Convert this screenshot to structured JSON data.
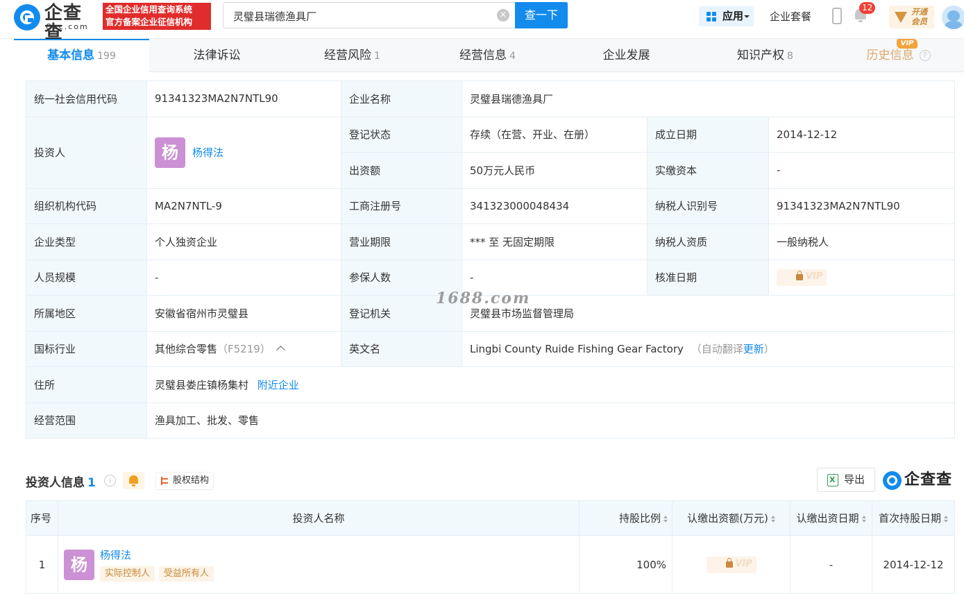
{
  "header": {
    "logo_cn": "企查查",
    "logo_en": "Qcc.com",
    "slogan_line1": "全国企业信用查询系统",
    "slogan_line2": "官方备案企业征信机构",
    "search_value": "灵璧县瑞德渔具厂",
    "search_button": "查一下",
    "app_label": "应用",
    "package_label": "企业套餐",
    "notification_count": "12",
    "vip_open_label": "开通会员",
    "accent_color": "#128bed"
  },
  "tabs": [
    {
      "label": "基本信息",
      "count": "199"
    },
    {
      "label": "法律诉讼",
      "count": ""
    },
    {
      "label": "经营风险",
      "count": "1"
    },
    {
      "label": "经营信息",
      "count": "4"
    },
    {
      "label": "企业发展",
      "count": ""
    },
    {
      "label": "知识产权",
      "count": "8"
    },
    {
      "label": "历史信息",
      "count": ""
    }
  ],
  "vip_tag": "VIP",
  "basic_info": {
    "credit_code_label": "统一社会信用代码",
    "credit_code": "91341323MA2N7NTL90",
    "company_name_label": "企业名称",
    "company_name": "灵璧县瑞德渔具厂",
    "investor_label": "投资人",
    "investor_avatar": "杨",
    "investor_name": "杨得法",
    "reg_status_label": "登记状态",
    "reg_status": "存续（在营、开业、在册）",
    "founded_label": "成立日期",
    "founded": "2014-12-12",
    "capital_label": "出资额",
    "capital": "50万元人民币",
    "paid_capital_label": "实缴资本",
    "paid_capital": "-",
    "org_code_label": "组织机构代码",
    "org_code": "MA2N7NTL-9",
    "biz_reg_no_label": "工商注册号",
    "biz_reg_no": "341323000048434",
    "taxpayer_id_label": "纳税人识别号",
    "taxpayer_id": "91341323MA2N7NTL90",
    "company_type_label": "企业类型",
    "company_type": "个人独资企业",
    "biz_term_label": "营业期限",
    "biz_term": "*** 至 无固定期限",
    "taxpayer_qual_label": "纳税人资质",
    "taxpayer_qual": "一般纳税人",
    "staff_size_label": "人员规模",
    "staff_size": "-",
    "insured_label": "参保人数",
    "insured": "-",
    "approval_date_label": "核准日期",
    "region_label": "所属地区",
    "region": "安徽省宿州市灵璧县",
    "reg_authority_label": "登记机关",
    "reg_authority": "灵璧县市场监督管理局",
    "industry_label": "国标行业",
    "industry": "其他综合零售",
    "industry_code": "（F5219）",
    "english_name_label": "英文名",
    "english_name": "Lingbi County Ruide Fishing Gear Factory",
    "auto_translate_prefix": "（自动翻译",
    "auto_translate_link": "更新",
    "auto_translate_suffix": "）",
    "address_label": "住所",
    "address": "灵璧县娄庄镇杨集村",
    "nearby_link": "附近企业",
    "scope_label": "经营范围",
    "scope": "渔具加工、批发、零售",
    "vip_lock_text": "VIP"
  },
  "watermark": "1688.com",
  "investor_section": {
    "title": "投资人信息",
    "count": "1",
    "equity_button": "股权结构",
    "export_button": "导出",
    "brand": "企查查",
    "columns": [
      "序号",
      "投资人名称",
      "持股比例",
      "认缴出资额(万元)",
      "认缴出资日期",
      "首次持股日期"
    ],
    "rows": [
      {
        "index": "1",
        "avatar": "杨",
        "name": "杨得法",
        "tags": [
          "实际控制人",
          "受益所有人"
        ],
        "share_ratio": "100%",
        "subscribed_amount_locked": "VIP",
        "subscribed_date": "-",
        "first_hold_date": "2014-12-12"
      }
    ]
  }
}
